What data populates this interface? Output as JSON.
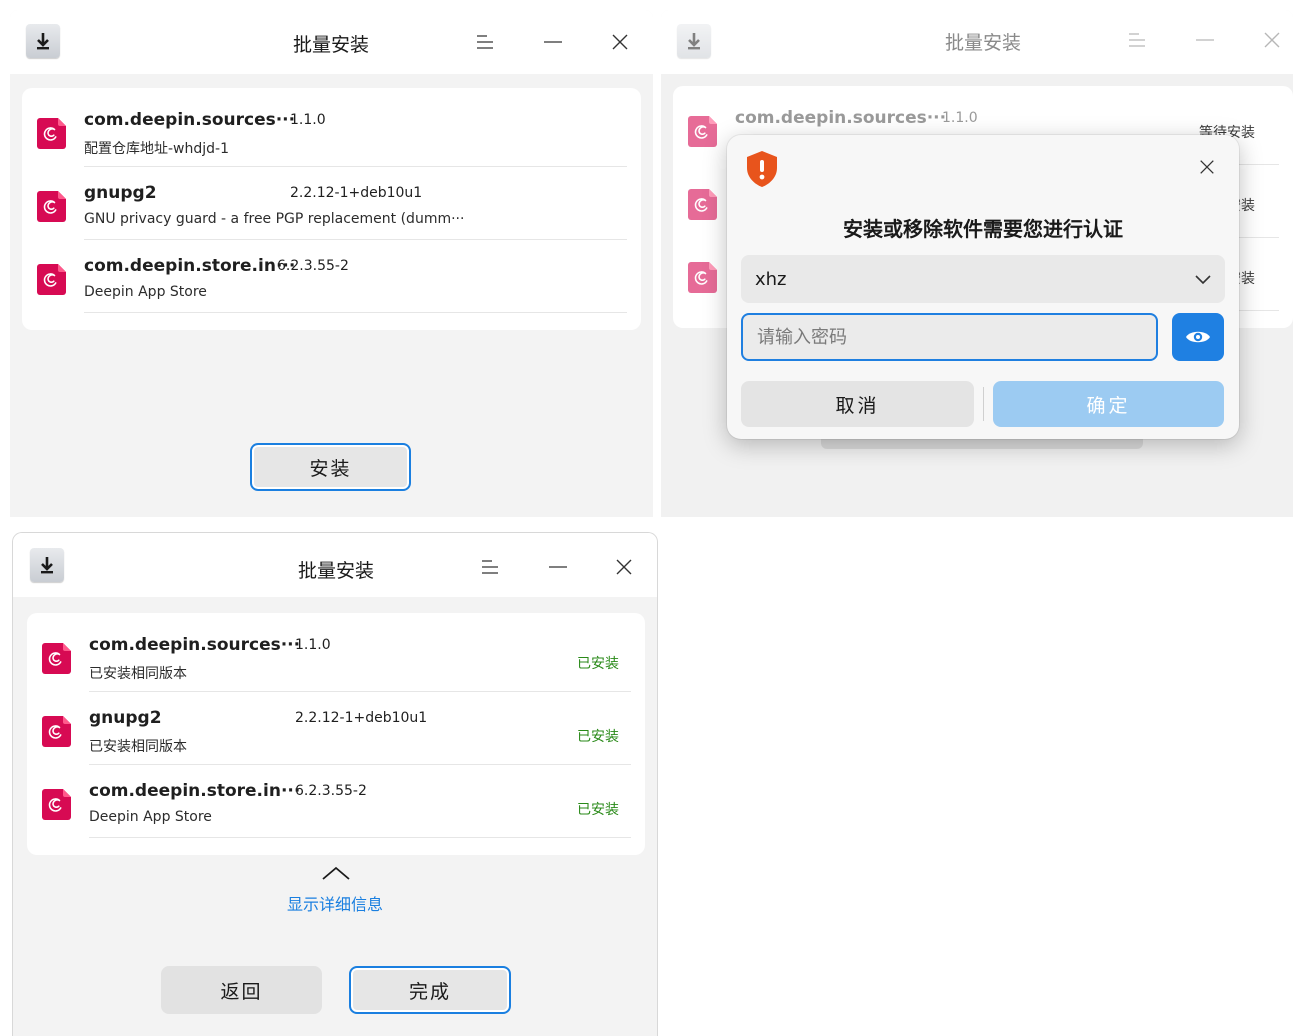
{
  "window1": {
    "title": "批量安装",
    "packages": [
      {
        "name": "com.deepin.sources···",
        "version": "1.1.0",
        "desc": "配置仓库地址-whdjd-1"
      },
      {
        "name": "gnupg2",
        "version": "2.2.12-1+deb10u1",
        "desc": "GNU privacy guard - a free PGP replacement (dumm···"
      },
      {
        "name": "com.deepin.store.in···",
        "version": "6.2.3.55-2",
        "desc": "Deepin App Store"
      }
    ],
    "install_label": "安装"
  },
  "window2": {
    "title": "批量安装",
    "packages": [
      {
        "name": "com.deepin.sources···",
        "version": "1.1.0",
        "status": "等待安装"
      },
      {
        "status": "安装"
      },
      {
        "status": "安装"
      }
    ],
    "dialog": {
      "title": "安装或移除软件需要您进行认证",
      "user": "xhz",
      "password_placeholder": "请输入密码",
      "cancel_label": "取消",
      "ok_label": "确定"
    }
  },
  "window3": {
    "title": "批量安装",
    "packages": [
      {
        "name": "com.deepin.sources···",
        "version": "1.1.0",
        "desc": "已安装相同版本",
        "status": "已安装"
      },
      {
        "name": "gnupg2",
        "version": "2.2.12-1+deb10u1",
        "desc": "已安装相同版本",
        "status": "已安装"
      },
      {
        "name": "com.deepin.store.in···",
        "version": "6.2.3.55-2",
        "desc": "Deepin App Store",
        "status": "已安装"
      }
    ],
    "details_label": "显示详细信息",
    "back_label": "返回",
    "done_label": "完成"
  },
  "colors": {
    "accent": "#1a7fe0",
    "installed": "#2a8a19",
    "deb_icon": "#d70a53",
    "shield": "#e8541c"
  }
}
